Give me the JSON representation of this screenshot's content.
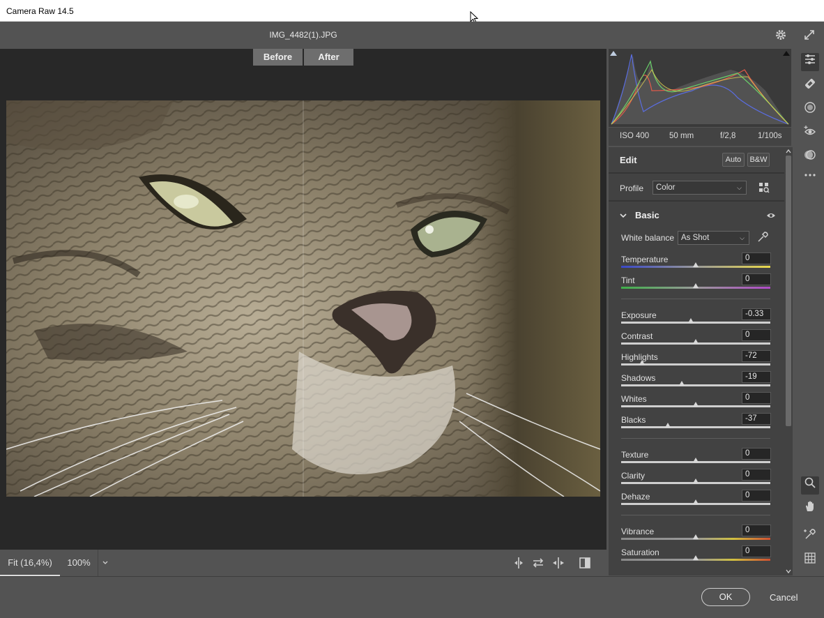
{
  "window": {
    "title": "Camera Raw 14.5"
  },
  "header": {
    "filename": "IMG_4482(1).JPG"
  },
  "view": {
    "before_label": "Before",
    "after_label": "After"
  },
  "bottom": {
    "fit_label": "Fit (16,4%)",
    "zoom_label": "100%"
  },
  "exif": {
    "iso": "ISO 400",
    "focal": "50 mm",
    "aperture": "f/2,8",
    "shutter": "1/100s"
  },
  "edit": {
    "title": "Edit",
    "auto_label": "Auto",
    "bw_label": "B&W",
    "profile_label": "Profile",
    "profile_value": "Color",
    "basic_title": "Basic",
    "wb_label": "White balance",
    "wb_value": "As Shot",
    "sliders": {
      "temperature": {
        "label": "Temperature",
        "value": "0",
        "level": 0.5
      },
      "tint": {
        "label": "Tint",
        "value": "0",
        "level": 0.5
      },
      "exposure": {
        "label": "Exposure",
        "value": "-0.33",
        "level": 0.467
      },
      "contrast": {
        "label": "Contrast",
        "value": "0",
        "level": 0.5
      },
      "highlights": {
        "label": "Highlights",
        "value": "-72",
        "level": 0.14
      },
      "shadows": {
        "label": "Shadows",
        "value": "-19",
        "level": 0.405
      },
      "whites": {
        "label": "Whites",
        "value": "0",
        "level": 0.5
      },
      "blacks": {
        "label": "Blacks",
        "value": "-37",
        "level": 0.315
      },
      "texture": {
        "label": "Texture",
        "value": "0",
        "level": 0.5
      },
      "clarity": {
        "label": "Clarity",
        "value": "0",
        "level": 0.5
      },
      "dehaze": {
        "label": "Dehaze",
        "value": "0",
        "level": 0.5
      },
      "vibrance": {
        "label": "Vibrance",
        "value": "0",
        "level": 0.5
      },
      "saturation": {
        "label": "Saturation",
        "value": "0",
        "level": 0.5
      }
    }
  },
  "footer": {
    "ok_label": "OK",
    "cancel_label": "Cancel"
  },
  "colors": {
    "panel": "#424242",
    "canvas": "#282828",
    "chrome": "#535353"
  }
}
